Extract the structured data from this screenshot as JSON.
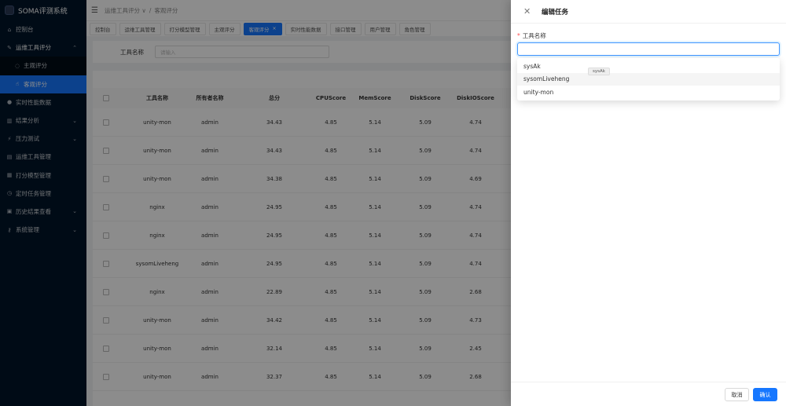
{
  "app": {
    "title": "SOMA评测系统"
  },
  "sidebar": {
    "items": [
      {
        "label": "控制台",
        "icon": "home-icon"
      },
      {
        "label": "运维工具评分",
        "icon": "tools-icon",
        "arrow": "⌃"
      },
      {
        "label": "主观评分",
        "icon": "circle-check-icon"
      },
      {
        "label": "客观评分",
        "icon": "thumb-icon"
      },
      {
        "label": "实时性能数据",
        "icon": "gauge-icon"
      },
      {
        "label": "结果分析",
        "icon": "chart-icon",
        "arrow": "⌄"
      },
      {
        "label": "压力测试",
        "icon": "bolt-icon",
        "arrow": "⌄"
      },
      {
        "label": "运维工具管理",
        "icon": "doc-icon"
      },
      {
        "label": "打分模型管理",
        "icon": "model-icon"
      },
      {
        "label": "定时任务管理",
        "icon": "clock-icon"
      },
      {
        "label": "历史结果查看",
        "icon": "history-icon",
        "arrow": "⌄"
      },
      {
        "label": "系统管理",
        "icon": "key-icon",
        "arrow": "⌄"
      }
    ]
  },
  "header": {
    "breadcrumb": [
      "运维工具评分 ∨",
      "客观评分"
    ]
  },
  "tabs": [
    "控制台",
    "运维工具管理",
    "打分模型管理",
    "主观评分",
    "客观评分",
    "实时性能数据",
    "接口管理",
    "用户管理",
    "角色管理"
  ],
  "search": {
    "label": "工具名称",
    "placeholder": "请输入"
  },
  "table": {
    "columns": [
      "工具名称",
      "所有者名称",
      "总分",
      "CPUScore",
      "MemScore",
      "DiskScore",
      "DiskIOScore"
    ],
    "rows": [
      [
        "unity-mon",
        "admin",
        "34.43",
        "4.85",
        "5.14",
        "5.09",
        "4.74"
      ],
      [
        "unity-mon",
        "admin",
        "34.43",
        "4.85",
        "5.14",
        "5.09",
        "4.74"
      ],
      [
        "unity-mon",
        "admin",
        "34.38",
        "4.85",
        "5.14",
        "5.09",
        "4.69"
      ],
      [
        "nginx",
        "admin",
        "24.95",
        "4.85",
        "5.14",
        "5.09",
        "4.74"
      ],
      [
        "nginx",
        "admin",
        "24.95",
        "4.85",
        "5.14",
        "5.09",
        "4.74"
      ],
      [
        "sysomLiveheng",
        "admin",
        "24.95",
        "4.85",
        "5.14",
        "5.09",
        "4.74"
      ],
      [
        "nginx",
        "admin",
        "22.89",
        "4.85",
        "5.14",
        "5.09",
        "2.68"
      ],
      [
        "unity-mon",
        "admin",
        "34.42",
        "4.85",
        "5.14",
        "5.09",
        "4.73"
      ],
      [
        "unity-mon",
        "admin",
        "32.14",
        "4.85",
        "5.14",
        "5.09",
        "2.45"
      ],
      [
        "unity-mon",
        "admin",
        "32.37",
        "4.85",
        "5.14",
        "5.09",
        "2.68"
      ]
    ]
  },
  "drawer": {
    "title": "编辑任务",
    "field_label": "工具名称",
    "required_mark": "*",
    "options": [
      "sysAk",
      "sysomLiveheng",
      "unity-mon"
    ],
    "tooltip": "sysAk",
    "cancel_label": "取消",
    "ok_label": "确认"
  },
  "colors": {
    "primary": "#1677ff",
    "sidebar_bg": "#001529",
    "danger": "#ff4d4f"
  }
}
